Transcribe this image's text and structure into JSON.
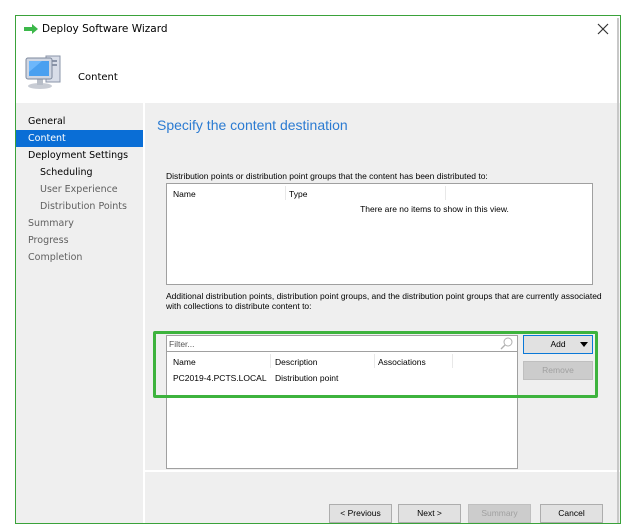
{
  "window": {
    "title": "Deploy Software Wizard",
    "close_label": "×"
  },
  "header": {
    "title": "Content"
  },
  "nav": {
    "items": [
      {
        "label": "General",
        "state": "normal"
      },
      {
        "label": "Content",
        "state": "active"
      },
      {
        "label": "Deployment Settings",
        "state": "normal"
      },
      {
        "label": "Scheduling",
        "state": "sub"
      },
      {
        "label": "User Experience",
        "state": "sub-dim"
      },
      {
        "label": "Distribution Points",
        "state": "sub-dim"
      },
      {
        "label": "Summary",
        "state": "dim"
      },
      {
        "label": "Progress",
        "state": "dim"
      },
      {
        "label": "Completion",
        "state": "dim"
      }
    ]
  },
  "main": {
    "page_title": "Specify the content destination",
    "distributed_label": "Distribution points or distribution point groups that the content has been distributed to:",
    "distributed_list": {
      "columns": [
        "Name",
        "Type"
      ],
      "empty_message": "There are no items to show in this view."
    },
    "additional_label": "Additional distribution points, distribution point groups, and the distribution point groups that are currently associated with collections to distribute content to:",
    "filter": {
      "placeholder": "Filter...",
      "value": ""
    },
    "additional_list": {
      "columns": [
        "Name",
        "Description",
        "Associations"
      ],
      "rows": [
        {
          "name": "PC2019-4.PCTS.LOCAL",
          "description": "Distribution point",
          "associations": ""
        }
      ]
    },
    "add_label": "Add",
    "remove_label": "Remove"
  },
  "footer": {
    "previous_label": "< Previous",
    "next_label": "Next >",
    "summary_label": "Summary",
    "cancel_label": "Cancel"
  },
  "colors": {
    "accent": "#0a6ed6",
    "title_blue": "#2b7bd2",
    "highlight_green": "#3db33d"
  }
}
